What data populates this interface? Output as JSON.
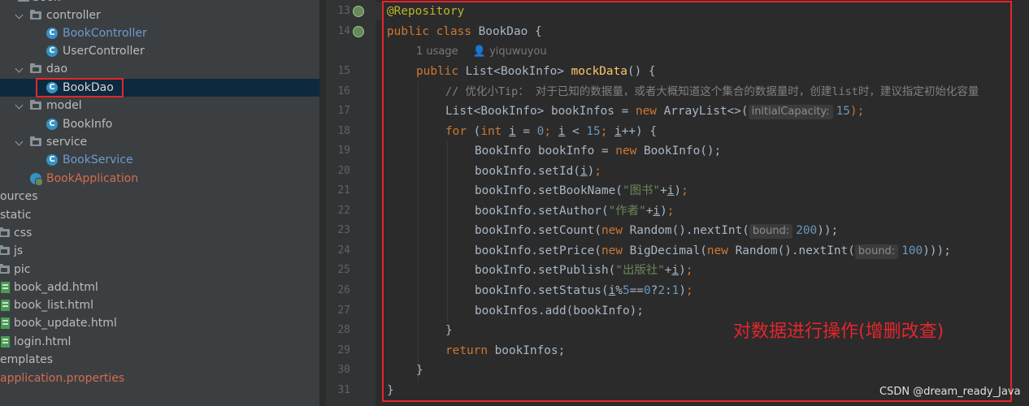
{
  "tree": {
    "root_partial": "book",
    "items": [
      {
        "label": "controller",
        "type": "folder"
      },
      {
        "label": "BookController",
        "type": "class"
      },
      {
        "label": "UserController",
        "type": "class"
      },
      {
        "label": "dao",
        "type": "folder"
      },
      {
        "label": "BookDao",
        "type": "class",
        "selected": true
      },
      {
        "label": "model",
        "type": "folder"
      },
      {
        "label": "BookInfo",
        "type": "class"
      },
      {
        "label": "service",
        "type": "folder"
      },
      {
        "label": "BookService",
        "type": "class"
      },
      {
        "label": "BookApplication",
        "type": "boot-class"
      },
      {
        "label": "ources",
        "type": "partial-folder"
      },
      {
        "label": "static",
        "type": "partial-folder"
      },
      {
        "label": "css",
        "type": "folder"
      },
      {
        "label": "js",
        "type": "folder"
      },
      {
        "label": "pic",
        "type": "folder"
      },
      {
        "label": "book_add.html",
        "type": "html"
      },
      {
        "label": "book_list.html",
        "type": "html"
      },
      {
        "label": "book_update.html",
        "type": "html"
      },
      {
        "label": "login.html",
        "type": "html"
      },
      {
        "label": "emplates",
        "type": "partial-folder"
      },
      {
        "label": "application.properties",
        "type": "properties"
      }
    ]
  },
  "editor": {
    "line_numbers": [
      "13",
      "14",
      "",
      "15",
      "16",
      "17",
      "18",
      "19",
      "20",
      "21",
      "22",
      "23",
      "24",
      "25",
      "26",
      "27",
      "28",
      "29",
      "30",
      "31"
    ],
    "usage_meta": {
      "usages": "1 usage",
      "author": "yiquwuyou"
    },
    "code": {
      "l13": "@Repository",
      "l14_kw": "public class",
      "l14_rest": " BookDao {",
      "l15_kw": "public",
      "l15_type": " List<BookInfo> ",
      "l15_fn": "mockData",
      "l15_rest": "() {",
      "l16": "// 优化小Tip： 对于已知的数据量，或者大概知道这个集合的数据量时，创建list时，建议指定初始化容量",
      "l17_a": "List<BookInfo> bookInfos = ",
      "l17_kw": "new",
      "l17_b": " ArrayList<>(",
      "l17_hint": "initialCapacity:",
      "l17_num": "15",
      "l17_c": ");",
      "l18_for": "for",
      "l18_int": "int",
      "l18_i": "i",
      "l18_zero": "0",
      "l18_fifteen": "15",
      "l19_a": "BookInfo bookInfo = ",
      "l19_kw": "new",
      "l19_b": " BookInfo();",
      "l20": "bookInfo.setId(",
      "l21_a": "bookInfo.setBookName(",
      "l21_str": "\"图书\"",
      "l22_a": "bookInfo.setAuthor(",
      "l22_str": "\"作者\"",
      "l23_a": "bookInfo.setCount(",
      "l23_kw": "new",
      "l23_b": " Random().nextInt(",
      "l23_hint": "bound:",
      "l23_num": "200",
      "l23_c": "));",
      "l24_a": "bookInfo.setPrice(",
      "l24_kw1": "new",
      "l24_b": " BigDecimal(",
      "l24_kw2": "new",
      "l24_c": " Random().nextInt(",
      "l24_hint": "bound:",
      "l24_num": "100",
      "l24_d": ")));",
      "l25_a": "bookInfo.setPublish(",
      "l25_str": "\"出版社\"",
      "l26_a": "bookInfo.setStatus(",
      "l26_num1": "5",
      "l26_num2": "0",
      "l26_num3": "2",
      "l26_num4": "1",
      "l27": "bookInfos.add(bookInfo);",
      "l28": "}",
      "l29_kw": "return",
      "l29_rest": " bookInfos;",
      "l30": "}",
      "l31": "}"
    }
  },
  "annotation_text": "对数据进行操作(增删改查)",
  "watermark": "CSDN @dream_ready_Java",
  "colors": {
    "highlight_red": "#e5252c",
    "keyword": "#cc7832",
    "annotation": "#bbb529",
    "method": "#ffc66d",
    "number": "#6897bb",
    "string": "#6a8759",
    "comment": "#808080"
  }
}
